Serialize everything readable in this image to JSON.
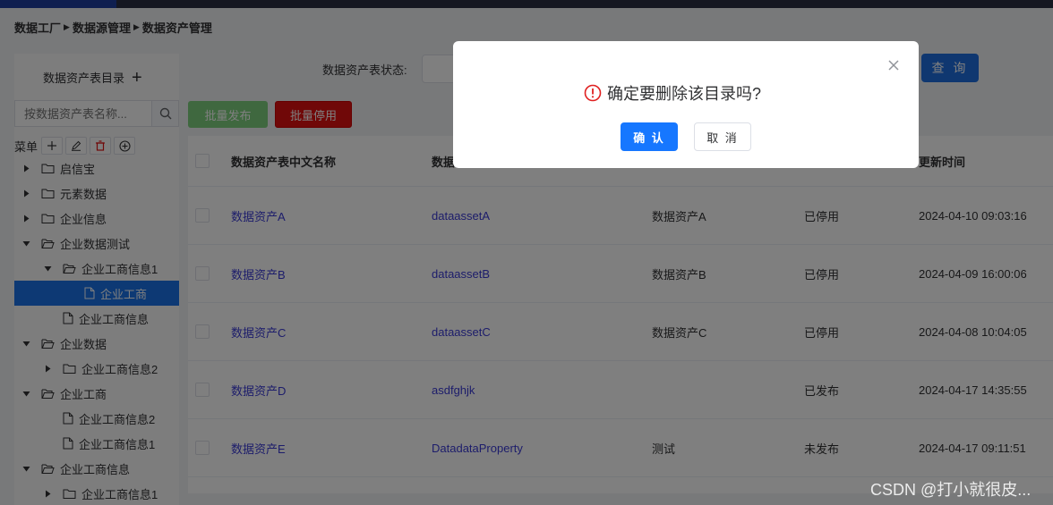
{
  "breadcrumb": [
    "数据工厂",
    "数据源管理",
    "数据资产管理"
  ],
  "sidebar": {
    "title": "数据资产表目录",
    "search_placeholder": "按数据资产表名称...",
    "menu_label": "菜单",
    "tree": [
      {
        "label": "启信宝",
        "level": 0,
        "expanded": false,
        "type": "folder"
      },
      {
        "label": "元素数据",
        "level": 0,
        "expanded": false,
        "type": "folder"
      },
      {
        "label": "企业信息",
        "level": 0,
        "expanded": false,
        "type": "folder"
      },
      {
        "label": "企业数据测试",
        "level": 0,
        "expanded": true,
        "type": "folder"
      },
      {
        "label": "企业工商信息1",
        "level": 1,
        "expanded": true,
        "type": "folder"
      },
      {
        "label": "企业工商",
        "level": 2,
        "type": "file",
        "selected": true
      },
      {
        "label": "企业工商信息",
        "level": 1,
        "type": "file"
      },
      {
        "label": "企业数据",
        "level": 0,
        "expanded": true,
        "type": "folder"
      },
      {
        "label": "企业工商信息2",
        "level": 1,
        "expanded": false,
        "type": "folder"
      },
      {
        "label": "企业工商",
        "level": 0,
        "expanded": true,
        "type": "folder"
      },
      {
        "label": "企业工商信息2",
        "level": 1,
        "type": "file"
      },
      {
        "label": "企业工商信息1",
        "level": 1,
        "type": "file"
      },
      {
        "label": "企业工商信息",
        "level": 0,
        "expanded": true,
        "type": "folder"
      },
      {
        "label": "企业工商信息1",
        "level": 1,
        "expanded": false,
        "type": "folder"
      }
    ]
  },
  "filter": {
    "status_label": "数据资产表状态:",
    "query_label": "查 询"
  },
  "actions": {
    "publish": "批量发布",
    "disable": "批量停用"
  },
  "table": {
    "columns": [
      "数据资产表中文名称",
      "数据",
      "更新时间"
    ],
    "rows": [
      {
        "cn_name": "数据资产A",
        "en_name": "dataassetA",
        "desc": "数据资产A",
        "status": "已停用",
        "updated": "2024-04-10 09:03:16"
      },
      {
        "cn_name": "数据资产B",
        "en_name": "dataassetB",
        "desc": "数据资产B",
        "status": "已停用",
        "updated": "2024-04-09 16:00:06"
      },
      {
        "cn_name": "数据资产C",
        "en_name": "dataassetC",
        "desc": "数据资产C",
        "status": "已停用",
        "updated": "2024-04-08 10:04:05"
      },
      {
        "cn_name": "数据资产D",
        "en_name": "asdfghjk",
        "desc": "",
        "status": "已发布",
        "updated": "2024-04-17 14:35:55"
      },
      {
        "cn_name": "数据资产E",
        "en_name": "DatadataProperty",
        "desc": "测试",
        "status": "未发布",
        "updated": "2024-04-17 09:11:51"
      }
    ]
  },
  "dialog": {
    "message": "确定要删除该目录吗?",
    "confirm": "确 认",
    "cancel": "取 消"
  },
  "watermark": "CSDN @打小就很皮...",
  "colors": {
    "primary": "#1677ff",
    "danger": "#e01010",
    "success_light": "#7fd07f",
    "link": "#3a3ad6",
    "warning_icon": "#e02020"
  }
}
